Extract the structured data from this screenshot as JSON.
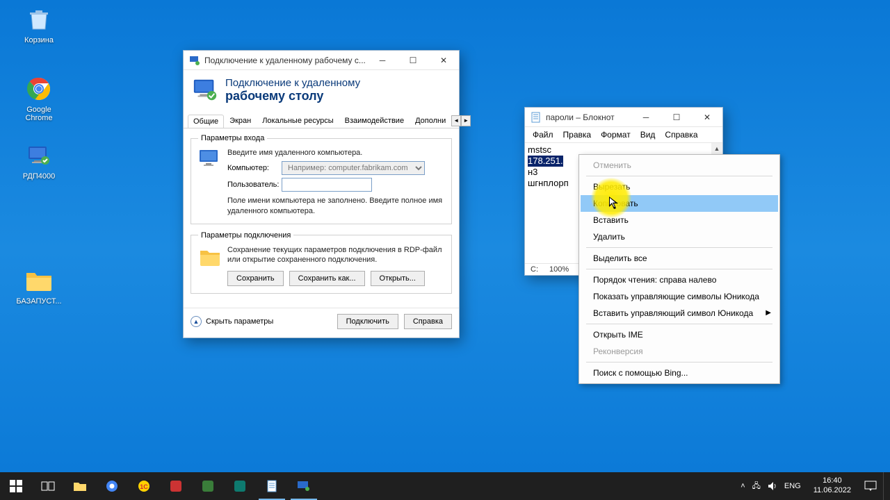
{
  "desktop": {
    "icons": {
      "recycle": "Корзина",
      "chrome": "Google Chrome",
      "rdp4000": "РДП4000",
      "bazapust": "БАЗАПУСТ..."
    }
  },
  "rdp": {
    "title": "Подключение к удаленному рабочему с...",
    "banner_line1": "Подключение к удаленному",
    "banner_line2": "рабочему столу",
    "tabs": {
      "general": "Общие",
      "screen": "Экран",
      "local": "Локальные ресурсы",
      "perf": "Взаимодействие",
      "extra": "Дополни"
    },
    "login_group": "Параметры входа",
    "login_hint": "Введите имя удаленного компьютера.",
    "computer_label": "Компьютер:",
    "computer_placeholder": "Например: computer.fabrikam.com",
    "user_label": "Пользователь:",
    "user_value": "",
    "empty_hint": "Поле имени компьютера не заполнено. Введите полное имя удаленного компьютера.",
    "conn_group": "Параметры подключения",
    "conn_hint": "Сохранение текущих параметров подключения в RDP-файл или открытие сохраненного подключения.",
    "save": "Сохранить",
    "save_as": "Сохранить как...",
    "open": "Открыть...",
    "hide_params": "Скрыть параметры",
    "connect": "Подключить",
    "help": "Справка"
  },
  "notepad": {
    "title": "пароли – Блокнот",
    "menu": {
      "file": "Файл",
      "edit": "Правка",
      "format": "Формат",
      "view": "Вид",
      "help": "Справка"
    },
    "lines": {
      "l1": "mstsc",
      "l2_sel": "178.251.",
      "l3": "н3",
      "l4": "шгнплорп"
    },
    "status_col": "C:",
    "status_zoom": "100%"
  },
  "context": {
    "undo": "Отменить",
    "cut": "Вырезать",
    "copy": "Копировать",
    "paste": "Вставить",
    "delete": "Удалить",
    "select_all": "Выделить все",
    "rtl": "Порядок чтения: справа налево",
    "show_unicode": "Показать управляющие символы Юникода",
    "insert_unicode": "Вставить управляющий символ Юникода",
    "open_ime": "Открыть IME",
    "reconvert": "Реконверсия",
    "bing": "Поиск с помощью Bing..."
  },
  "taskbar": {
    "lang": "ENG",
    "time": "16:40",
    "date": "11.06.2022"
  }
}
